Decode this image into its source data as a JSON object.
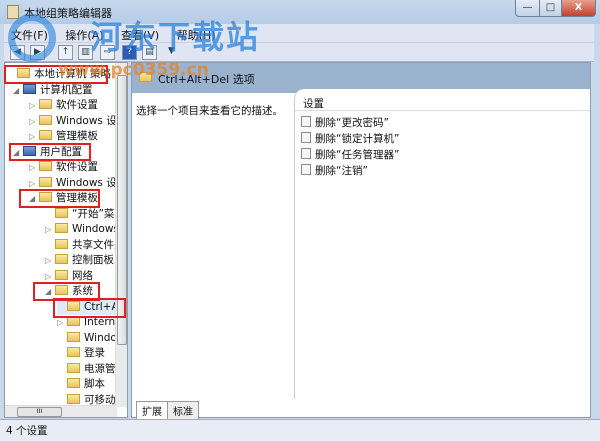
{
  "window": {
    "title": "本地组策略编辑器",
    "minimize": "—",
    "maximize": "□",
    "close": "X"
  },
  "menu": [
    "文件(F)",
    "操作(A)",
    "查看(V)",
    "帮助(H)"
  ],
  "toolbar": {
    "icons": [
      "back-icon",
      "forward-icon",
      "up-icon",
      "show-hide-tree-icon",
      "export-icon",
      "help-icon",
      "extended-view-icon",
      "filter-icon"
    ]
  },
  "tree": [
    {
      "label": "本地计算机 策略",
      "level": 0,
      "arrow": ""
    },
    {
      "label": "计算机配置",
      "level": 1,
      "arrow": "◢"
    },
    {
      "label": "软件设置",
      "level": 2,
      "arrow": "▷"
    },
    {
      "label": "Windows 设置",
      "level": 2,
      "arrow": "▷"
    },
    {
      "label": "管理模板",
      "level": 2,
      "arrow": "▷"
    },
    {
      "label": "用户配置",
      "level": 1,
      "arrow": "◢"
    },
    {
      "label": "软件设置",
      "level": 2,
      "arrow": "▷"
    },
    {
      "label": "Windows 设置",
      "level": 2,
      "arrow": "▷"
    },
    {
      "label": "管理模板",
      "level": 2,
      "arrow": "◢"
    },
    {
      "label": "“开始”菜单",
      "level": 3,
      "arrow": ""
    },
    {
      "label": "Windows",
      "level": 3,
      "arrow": "▷"
    },
    {
      "label": "共享文件夹",
      "level": 3,
      "arrow": ""
    },
    {
      "label": "控制面板",
      "level": 3,
      "arrow": "▷"
    },
    {
      "label": "网络",
      "level": 3,
      "arrow": "▷"
    },
    {
      "label": "系统",
      "level": 3,
      "arrow": "◢"
    },
    {
      "label": "Ctrl+Alt+Del",
      "level": 4,
      "arrow": ""
    },
    {
      "label": "Internet",
      "level": 4,
      "arrow": "▷"
    },
    {
      "label": "Windows",
      "level": 4,
      "arrow": ""
    },
    {
      "label": "登录",
      "level": 4,
      "arrow": ""
    },
    {
      "label": "电源管理",
      "level": 4,
      "arrow": ""
    },
    {
      "label": "脚本",
      "level": 4,
      "arrow": ""
    },
    {
      "label": "可移动",
      "level": 4,
      "arrow": ""
    }
  ],
  "right": {
    "header": "Ctrl+Alt+Del 选项",
    "description": "选择一个项目来查看它的描述。",
    "column": "设置",
    "settings": [
      "删除“更改密码”",
      "删除“锁定计算机”",
      "删除“任务管理器”",
      "删除“注销”"
    ],
    "tabs": [
      "扩展",
      "标准"
    ]
  },
  "status": "4 个设置",
  "watermark": {
    "site": "河东下载站",
    "url": "www.pc0359.cn"
  }
}
